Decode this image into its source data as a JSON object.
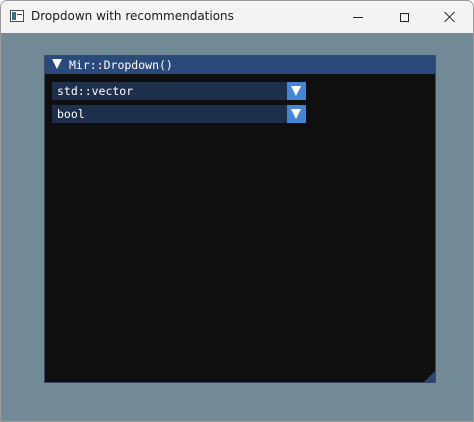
{
  "window": {
    "title": "Dropdown with recommendations",
    "icon": "app-window-icon",
    "controls": {
      "minimize_icon": "minimize-icon",
      "maximize_icon": "maximize-icon",
      "close_icon": "close-icon"
    }
  },
  "panel": {
    "title": "Mir::Dropdown()",
    "collapse_icon": "triangle-down-icon",
    "dropdowns": [
      {
        "value": "std::vector",
        "arrow_icon": "triangle-down-icon"
      },
      {
        "value": "bool",
        "arrow_icon": "triangle-down-icon"
      }
    ]
  },
  "colors": {
    "client_background": "#728a95",
    "panel_background": "#0f0f0f",
    "panel_titlebar": "#294a7a",
    "combo_background": "#1d2f4a",
    "combo_button": "#4585d6",
    "text": "#ffffff"
  }
}
